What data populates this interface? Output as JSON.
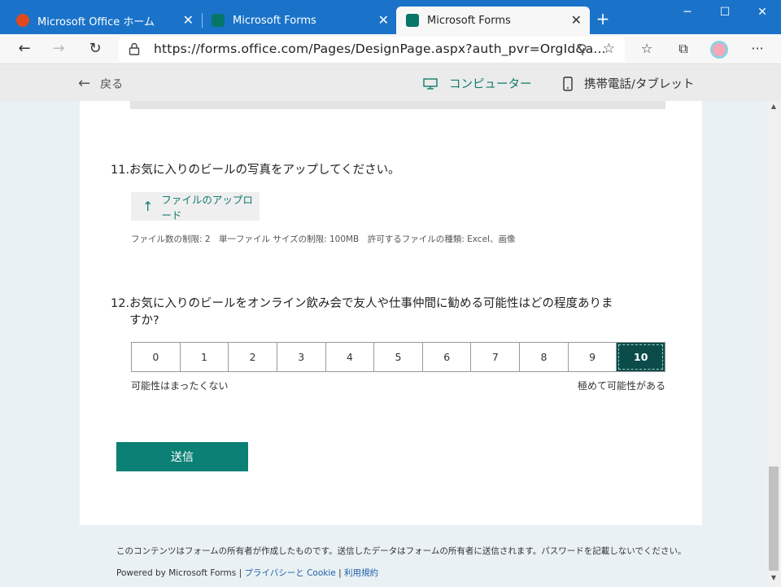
{
  "tabs": [
    {
      "title": "Microsoft Office ホーム",
      "icon": "office-icon",
      "active": false
    },
    {
      "title": "Microsoft Forms",
      "icon": "forms-icon",
      "active": false
    },
    {
      "title": "Microsoft Forms",
      "icon": "forms-icon",
      "active": true
    }
  ],
  "address": {
    "url": "https://forms.office.com/Pages/DesignPage.aspx?auth_pvr=OrgId&a..."
  },
  "preview": {
    "back_label": "戻る",
    "computer_label": "コンピューター",
    "mobile_label": "携帯電話/タブレット"
  },
  "questions": [
    {
      "number": "11.",
      "title": "お気に入りのビールの写真をアップしてください。",
      "upload_label": "ファイルのアップロード",
      "limits": "ファイル数の制限: 2　単一ファイル サイズの制限: 100MB　許可するファイルの種類: Excel、画像"
    },
    {
      "number": "12.",
      "title_line1": "お気に入りのビールをオンライン飲み会で友人や仕事仲間に勧める可能性はどの程度ありま",
      "title_line2": "すか?",
      "scale": [
        "0",
        "1",
        "2",
        "3",
        "4",
        "5",
        "6",
        "7",
        "8",
        "9",
        "10"
      ],
      "selected": "10",
      "low_label": "可能性はまったくない",
      "high_label": "極めて可能性がある"
    }
  ],
  "submit_label": "送信",
  "footer": {
    "notice": "このコンテンツはフォームの所有者が作成したものです。送信したデータはフォームの所有者に送信されます。パスワードを記載しないでください。",
    "powered": "Powered by Microsoft Forms |",
    "privacy": "プライバシーと Cookie",
    "sep": "|",
    "terms": "利用規約"
  },
  "colors": {
    "titlebar": "#1a73c9",
    "accent": "#0d8075",
    "selected_cell": "#0b4c4a"
  }
}
